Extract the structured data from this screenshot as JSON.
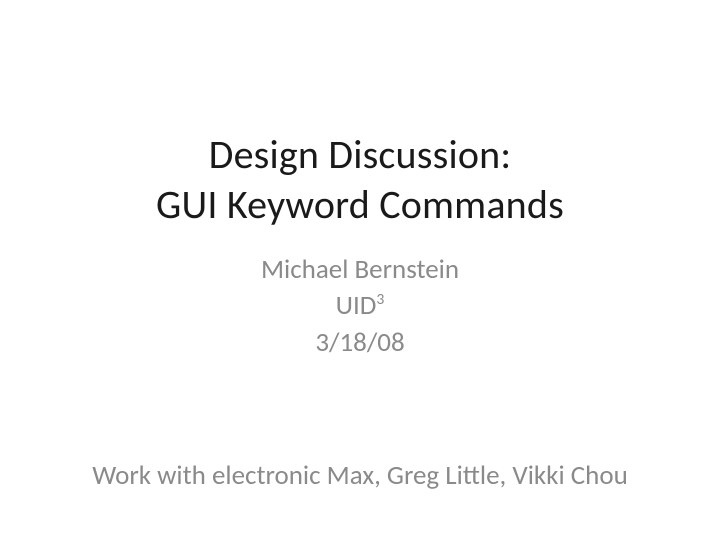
{
  "title": {
    "line1": "Design Discussion:",
    "line2": "GUI Keyword Commands"
  },
  "subtitle": {
    "author": "Michael Bernstein",
    "affiliation_base": "UID",
    "affiliation_sup": "3",
    "date": "3/18/08"
  },
  "credits": "Work with electronic Max, Greg Little, Vikki Chou"
}
